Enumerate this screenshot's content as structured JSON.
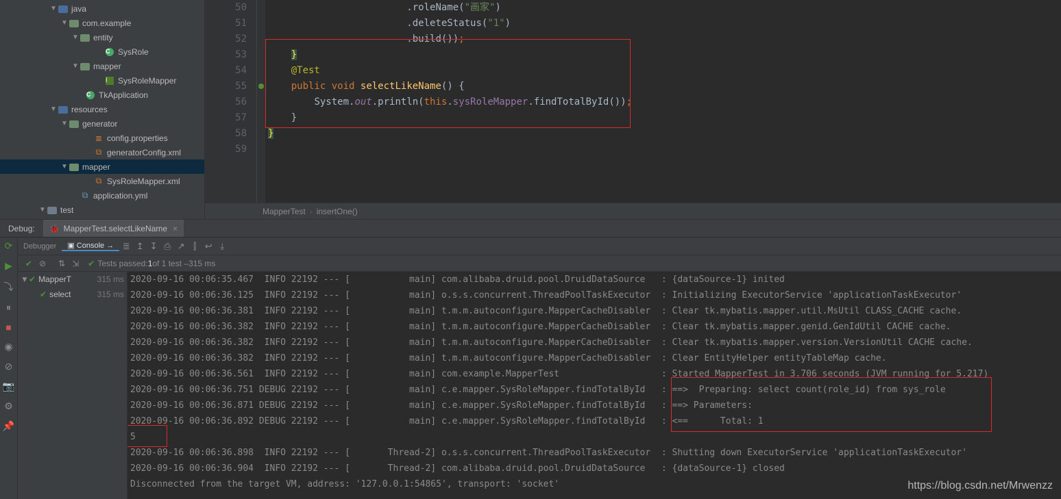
{
  "tree": {
    "items": [
      {
        "idn": 0,
        "indent": 72,
        "arrow": "▼",
        "ico": "folder-src",
        "lbl": "java"
      },
      {
        "idn": 1,
        "indent": 88,
        "arrow": "▼",
        "ico": "folder-pkg",
        "lbl": "com.example"
      },
      {
        "idn": 2,
        "indent": 104,
        "arrow": "▼",
        "ico": "folder-pkg",
        "lbl": "entity"
      },
      {
        "idn": 3,
        "indent": 140,
        "arrow": "",
        "ico": "class",
        "lbl": "SysRole"
      },
      {
        "idn": 4,
        "indent": 104,
        "arrow": "▼",
        "ico": "folder-pkg",
        "lbl": "mapper"
      },
      {
        "idn": 5,
        "indent": 140,
        "arrow": "",
        "ico": "iface",
        "lbl": "SysRoleMapper"
      },
      {
        "idn": 6,
        "indent": 112,
        "arrow": "",
        "ico": "class",
        "lbl": "TkApplication"
      },
      {
        "idn": 7,
        "indent": 72,
        "arrow": "▼",
        "ico": "folder-src",
        "lbl": "resources"
      },
      {
        "idn": 8,
        "indent": 88,
        "arrow": "▼",
        "ico": "folder-pkg",
        "lbl": "generator"
      },
      {
        "idn": 9,
        "indent": 124,
        "arrow": "",
        "ico": "prop",
        "lbl": "config.properties"
      },
      {
        "idn": 10,
        "indent": 124,
        "arrow": "",
        "ico": "xml",
        "lbl": "generatorConfig.xml"
      },
      {
        "idn": 11,
        "indent": 88,
        "arrow": "▼",
        "ico": "folder-pkg",
        "lbl": "mapper",
        "sel": true
      },
      {
        "idn": 12,
        "indent": 124,
        "arrow": "",
        "ico": "xml",
        "lbl": "SysRoleMapper.xml"
      },
      {
        "idn": 13,
        "indent": 104,
        "arrow": "",
        "ico": "yml",
        "lbl": "application.yml"
      },
      {
        "idn": 14,
        "indent": 56,
        "arrow": "▼",
        "ico": "folder",
        "lbl": "test"
      }
    ]
  },
  "gutter": {
    "start": 50,
    "end": 59
  },
  "code": {
    "50": {
      "pre": "                        ",
      "parts": [
        {
          "c": "wh",
          "t": ".roleName("
        },
        {
          "c": "str",
          "t": "\"画家\""
        },
        {
          "c": "wh",
          "t": ")"
        }
      ]
    },
    "51": {
      "pre": "                        ",
      "parts": [
        {
          "c": "wh",
          "t": ".deleteStatus("
        },
        {
          "c": "str",
          "t": "\"1\""
        },
        {
          "c": "wh",
          "t": ")"
        }
      ]
    },
    "52": {
      "pre": "                        ",
      "parts": [
        {
          "c": "wh",
          "t": ".build())"
        },
        {
          "c": "sc",
          "t": ";"
        }
      ]
    },
    "53": {
      "pre": "    ",
      "parts": [
        {
          "c": "brace-hi",
          "t": "}"
        }
      ]
    },
    "54": {
      "pre": "    ",
      "parts": [
        {
          "c": "ann",
          "t": "@Test"
        }
      ]
    },
    "55": {
      "pre": "    ",
      "parts": [
        {
          "c": "kw",
          "t": "public"
        },
        {
          "c": "wh",
          "t": " "
        },
        {
          "c": "kw",
          "t": "void"
        },
        {
          "c": "wh",
          "t": " "
        },
        {
          "c": "mname",
          "t": "selectLikeName"
        },
        {
          "c": "wh",
          "t": "() {"
        }
      ]
    },
    "56": {
      "pre": "        ",
      "parts": [
        {
          "c": "wh",
          "t": "System."
        },
        {
          "c": "st",
          "t": "out"
        },
        {
          "c": "wh",
          "t": ".println("
        },
        {
          "c": "kw",
          "t": "this"
        },
        {
          "c": "wh",
          "t": "."
        },
        {
          "c": "fld",
          "t": "sysRoleMapper"
        },
        {
          "c": "wh",
          "t": ".findTotalById())"
        },
        {
          "c": "sc",
          "t": ";"
        }
      ]
    },
    "57": {
      "pre": "    ",
      "parts": [
        {
          "c": "wh",
          "t": "}"
        }
      ]
    },
    "58": {
      "pre": "",
      "parts": [
        {
          "c": "brace-hi",
          "t": "}"
        }
      ]
    },
    "59": {
      "pre": "",
      "parts": []
    }
  },
  "breadcrumb": {
    "a": "MapperTest",
    "b": "insertOne()"
  },
  "debug": {
    "title": "Debug:",
    "tab": "MapperTest.selectLikeName",
    "debuggerTab": "Debugger",
    "consoleTab": "Console",
    "status_prefix": "Tests passed: ",
    "status_passed": "1",
    "status_mid": " of 1 test – ",
    "status_time": "315 ms",
    "tree": [
      {
        "lbl": "MapperT",
        "time": "315 ms",
        "arrow": "▼"
      },
      {
        "lbl": "select",
        "time": "315 ms",
        "arrow": ""
      }
    ]
  },
  "console": [
    "2020-09-16 00:06:35.467  INFO 22192 --- [           main] com.alibaba.druid.pool.DruidDataSource   : {dataSource-1} inited",
    "2020-09-16 00:06:36.125  INFO 22192 --- [           main] o.s.s.concurrent.ThreadPoolTaskExecutor  : Initializing ExecutorService 'applicationTaskExecutor'",
    "2020-09-16 00:06:36.381  INFO 22192 --- [           main] t.m.m.autoconfigure.MapperCacheDisabler  : Clear tk.mybatis.mapper.util.MsUtil CLASS_CACHE cache.",
    "2020-09-16 00:06:36.382  INFO 22192 --- [           main] t.m.m.autoconfigure.MapperCacheDisabler  : Clear tk.mybatis.mapper.genid.GenIdUtil CACHE cache.",
    "2020-09-16 00:06:36.382  INFO 22192 --- [           main] t.m.m.autoconfigure.MapperCacheDisabler  : Clear tk.mybatis.mapper.version.VersionUtil CACHE cache.",
    "2020-09-16 00:06:36.382  INFO 22192 --- [           main] t.m.m.autoconfigure.MapperCacheDisabler  : Clear EntityHelper entityTableMap cache.",
    "2020-09-16 00:06:36.561  INFO 22192 --- [           main] com.example.MapperTest                   : Started MapperTest in 3.706 seconds (JVM running for 5.217)",
    "2020-09-16 00:06:36.751 DEBUG 22192 --- [           main] c.e.mapper.SysRoleMapper.findTotalById   : ==>  Preparing: select count(role_id) from sys_role ",
    "2020-09-16 00:06:36.871 DEBUG 22192 --- [           main] c.e.mapper.SysRoleMapper.findTotalById   : ==> Parameters: ",
    "2020-09-16 00:06:36.892 DEBUG 22192 --- [           main] c.e.mapper.SysRoleMapper.findTotalById   : <==      Total: 1",
    "5",
    "2020-09-16 00:06:36.898  INFO 22192 --- [       Thread-2] o.s.s.concurrent.ThreadPoolTaskExecutor  : Shutting down ExecutorService 'applicationTaskExecutor'",
    "2020-09-16 00:06:36.904  INFO 22192 --- [       Thread-2] com.alibaba.druid.pool.DruidDataSource   : {dataSource-1} closed",
    "Disconnected from the target VM, address: '127.0.0.1:54865', transport: 'socket'"
  ],
  "watermark": "https://blog.csdn.net/Mrwenzz"
}
